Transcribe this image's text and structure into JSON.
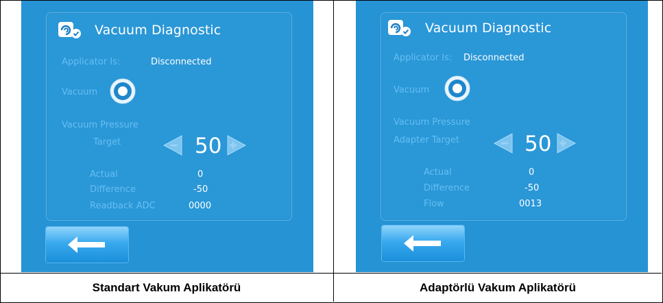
{
  "left": {
    "caption": "Standart Vakum Aplikatörü",
    "screen": {
      "title": "Vacuum Diagnostic",
      "applicator_label": "Applicator Is:",
      "applicator_value": "Disconnected",
      "vacuum_label": "Vacuum",
      "pressure_label": "Vacuum Pressure",
      "target_label": "Target",
      "target_value": "50",
      "actual_label": "Actual",
      "actual_value": "0",
      "difference_label": "Difference",
      "difference_value": "-50",
      "extra_label": "Readback ADC",
      "extra_value": "0000"
    }
  },
  "right": {
    "caption": "Adaptörlü Vakum Aplikatörü",
    "screen": {
      "title": "Vacuum Diagnostic",
      "applicator_label": "Applicator Is:",
      "applicator_value": "Disconnected",
      "vacuum_label": "Vacuum",
      "pressure_label": "Vacuum Pressure",
      "target_label": "Adapter Target",
      "target_value": "50",
      "actual_label": "Actual",
      "actual_value": "0",
      "difference_label": "Difference",
      "difference_value": "-50",
      "extra_label": "Flow",
      "extra_value": "0013"
    }
  },
  "icons": {
    "title": "vacuum-diagnostic-icon",
    "vacuum": "vacuum-toggle-icon",
    "decrease": "decrease-arrow-icon",
    "increase": "increase-arrow-icon",
    "back": "back-arrow-icon"
  },
  "colors": {
    "screen_bg": "#2693d4",
    "label_text": "#66bff2",
    "value_text": "#ffffff"
  }
}
